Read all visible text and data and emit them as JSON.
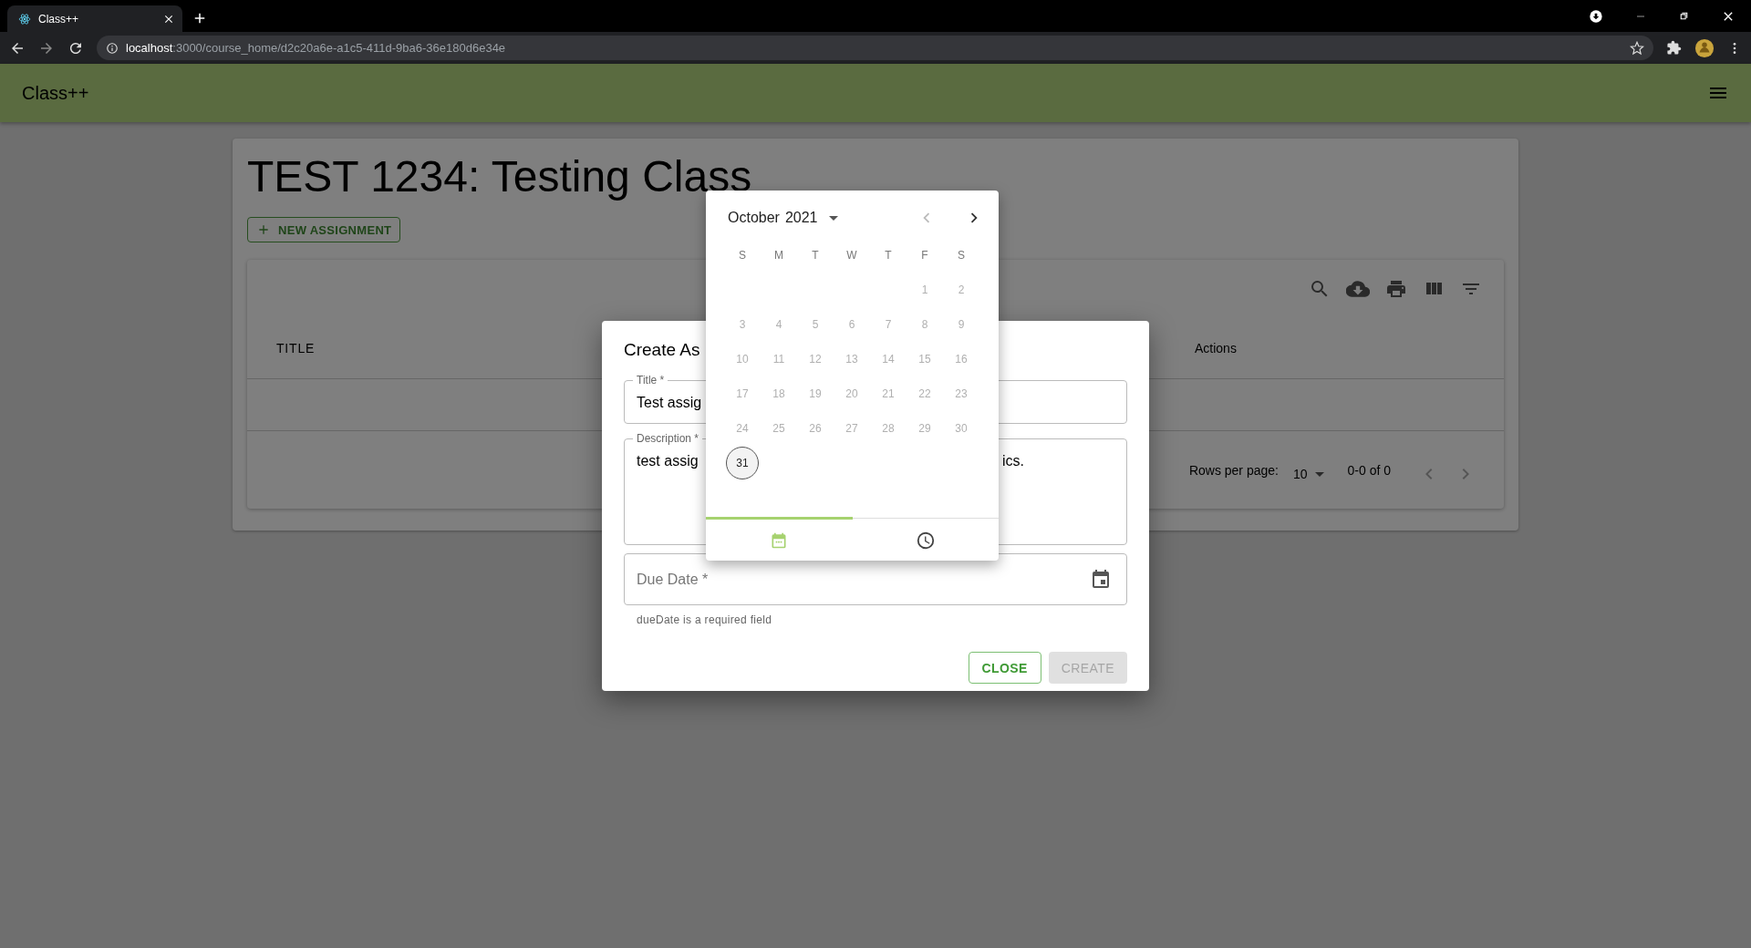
{
  "browser": {
    "tab": {
      "title": "Class++"
    },
    "address": {
      "host": "localhost",
      "path": ":3000/course_home/d2c20a6e-a1c5-411d-9ba6-36e180d6e34e"
    }
  },
  "app_bar": {
    "title": "Class++"
  },
  "course": {
    "title": "TEST 1234: Testing Class",
    "new_button": "NEW ASSIGNMENT"
  },
  "table": {
    "columns": [
      "TITLE",
      "Actions"
    ],
    "rows_per_page_label": "Rows per page:",
    "rows_per_page": "10",
    "range": "0-0 of 0"
  },
  "dialog": {
    "title": "Create As",
    "fields": [
      {
        "kind": "text",
        "label": "Title *",
        "value": "Test assig"
      },
      {
        "kind": "multiline",
        "label": "Description *",
        "value": "test assig",
        "value_end": "ics."
      },
      {
        "kind": "date",
        "placeholder": "Due Date *",
        "helper": "dueDate is a required field"
      }
    ],
    "buttons": [
      {
        "label": "CLOSE",
        "disabled": false
      },
      {
        "label": "CREATE",
        "disabled": true
      }
    ]
  },
  "date_picker": {
    "month": "October",
    "year": "2021",
    "weekdays": [
      "S",
      "M",
      "T",
      "W",
      "T",
      "F",
      "S"
    ],
    "weeks": [
      [
        {
          "label": "1",
          "disabled": true,
          "selected": false
        },
        {
          "label": "2",
          "disabled": true,
          "selected": false
        }
      ],
      [
        {
          "label": "3",
          "disabled": true,
          "selected": false
        },
        {
          "label": "4",
          "disabled": true,
          "selected": false
        },
        {
          "label": "5",
          "disabled": true,
          "selected": false
        },
        {
          "label": "6",
          "disabled": true,
          "selected": false
        },
        {
          "label": "7",
          "disabled": true,
          "selected": false
        },
        {
          "label": "8",
          "disabled": true,
          "selected": false
        },
        {
          "label": "9",
          "disabled": true,
          "selected": false
        }
      ],
      [
        {
          "label": "10",
          "disabled": true,
          "selected": false
        },
        {
          "label": "11",
          "disabled": true,
          "selected": false
        },
        {
          "label": "12",
          "disabled": true,
          "selected": false
        },
        {
          "label": "13",
          "disabled": true,
          "selected": false
        },
        {
          "label": "14",
          "disabled": true,
          "selected": false
        },
        {
          "label": "15",
          "disabled": true,
          "selected": false
        },
        {
          "label": "16",
          "disabled": true,
          "selected": false
        }
      ],
      [
        {
          "label": "17",
          "disabled": true,
          "selected": false
        },
        {
          "label": "18",
          "disabled": true,
          "selected": false
        },
        {
          "label": "19",
          "disabled": true,
          "selected": false
        },
        {
          "label": "20",
          "disabled": true,
          "selected": false
        },
        {
          "label": "21",
          "disabled": true,
          "selected": false
        },
        {
          "label": "22",
          "disabled": true,
          "selected": false
        },
        {
          "label": "23",
          "disabled": true,
          "selected": false
        }
      ],
      [
        {
          "label": "24",
          "disabled": true,
          "selected": false
        },
        {
          "label": "25",
          "disabled": true,
          "selected": false
        },
        {
          "label": "26",
          "disabled": true,
          "selected": false
        },
        {
          "label": "27",
          "disabled": true,
          "selected": false
        },
        {
          "label": "28",
          "disabled": true,
          "selected": false
        },
        {
          "label": "29",
          "disabled": true,
          "selected": false
        },
        {
          "label": "30",
          "disabled": true,
          "selected": false
        }
      ],
      [
        {
          "label": "31",
          "disabled": false,
          "selected": true
        }
      ]
    ],
    "tabs": [
      {
        "kind": "date",
        "selected": true
      },
      {
        "kind": "time",
        "selected": false
      }
    ]
  }
}
